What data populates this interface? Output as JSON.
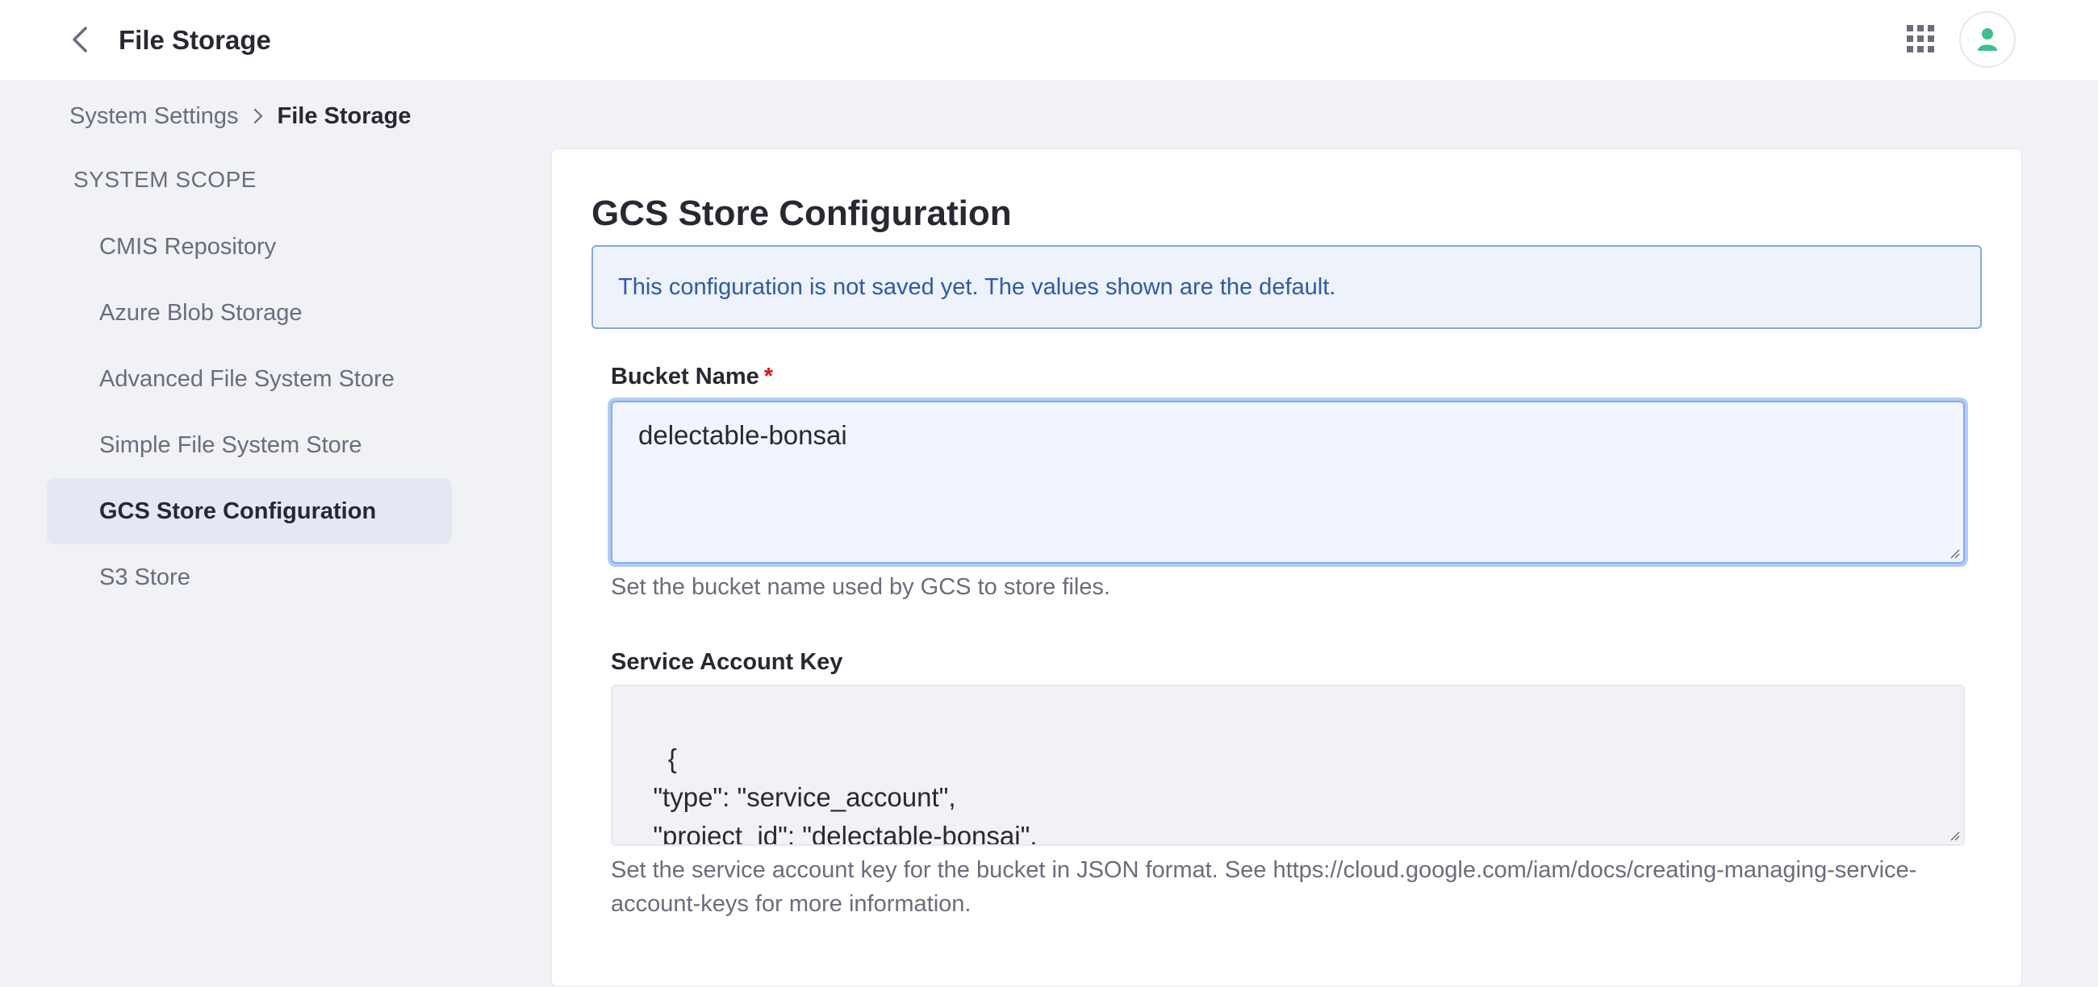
{
  "header": {
    "title": "File Storage",
    "back_icon": "chevron-left-icon",
    "apps_icon": "grid-icon",
    "user_icon": "user-icon"
  },
  "breadcrumb": {
    "parent": "System Settings",
    "current": "File Storage"
  },
  "sidebar": {
    "heading": "SYSTEM SCOPE",
    "items": [
      {
        "label": "CMIS Repository"
      },
      {
        "label": "Azure Blob Storage"
      },
      {
        "label": "Advanced File System Store"
      },
      {
        "label": "Simple File System Store"
      },
      {
        "label": "GCS Store Configuration",
        "active": true
      },
      {
        "label": "S3 Store"
      }
    ]
  },
  "main": {
    "title": "GCS Store Configuration",
    "alert": "This configuration is not saved yet. The values shown are the default.",
    "bucket_name": {
      "label": "Bucket Name",
      "required_mark": "*",
      "value": "delectable-bonsai",
      "help": "Set the bucket name used by GCS to store files."
    },
    "service_account_key": {
      "label": "Service Account Key",
      "value": "{\n  \"type\": \"service_account\",\n  \"project_id\": \"delectable-bonsai\",\n  \"private_key_id\": \"key-id\",",
      "help_line1": "Set the service account key for the bucket in JSON format. See https://cloud.google.com/iam/docs/creating-managing-service-",
      "help_line2": "account-keys for more information."
    }
  },
  "colors": {
    "accent": "#80acff",
    "alert_text": "#2e5aac",
    "avatar": "#3dbf8d"
  }
}
